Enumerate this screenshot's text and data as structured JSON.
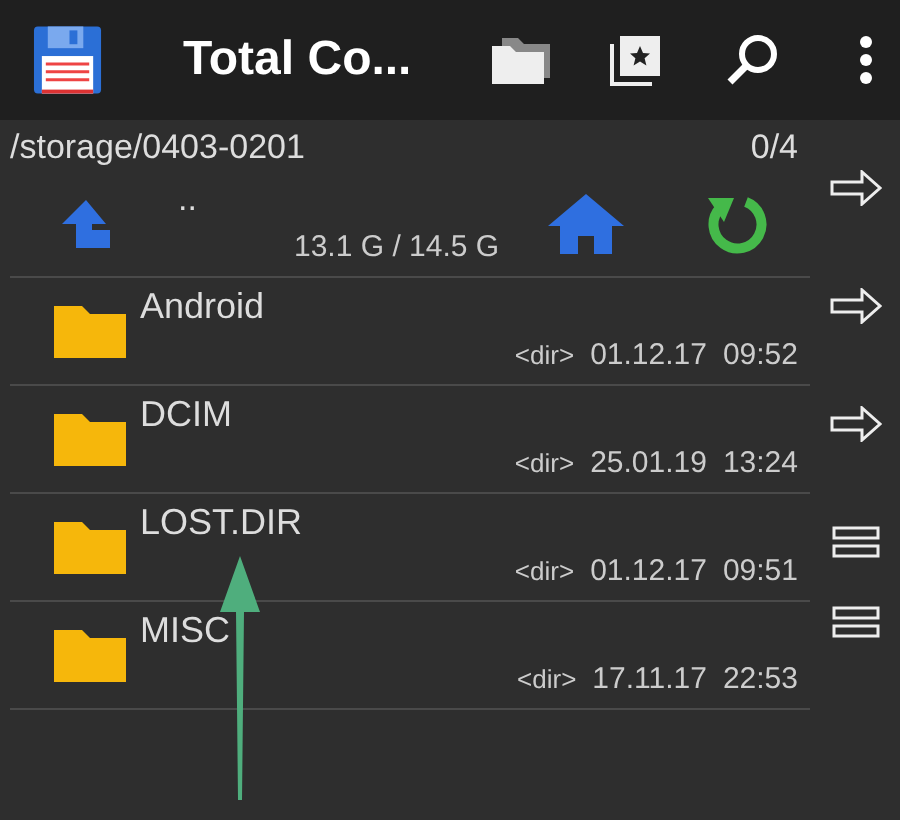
{
  "toolbar": {
    "title": "Total Co..."
  },
  "panel": {
    "path": "/storage/0403-0201",
    "count": "0/4",
    "parent": {
      "label": "..",
      "space": "13.1 G / 14.5 G"
    },
    "files": [
      {
        "name": "Android",
        "type": "<dir>",
        "date": "01.12.17",
        "time": "09:52"
      },
      {
        "name": "DCIM",
        "type": "<dir>",
        "date": "25.01.19",
        "time": "13:24"
      },
      {
        "name": "LOST.DIR",
        "type": "<dir>",
        "date": "01.12.17",
        "time": "09:51"
      },
      {
        "name": "MISC",
        "type": "<dir>",
        "date": "17.11.17",
        "time": "22:53"
      }
    ]
  },
  "side_buttons": [
    {
      "kind": "arrow"
    },
    {
      "kind": "arrow"
    },
    {
      "kind": "arrow"
    },
    {
      "kind": "lines"
    },
    {
      "kind": "lines"
    }
  ]
}
